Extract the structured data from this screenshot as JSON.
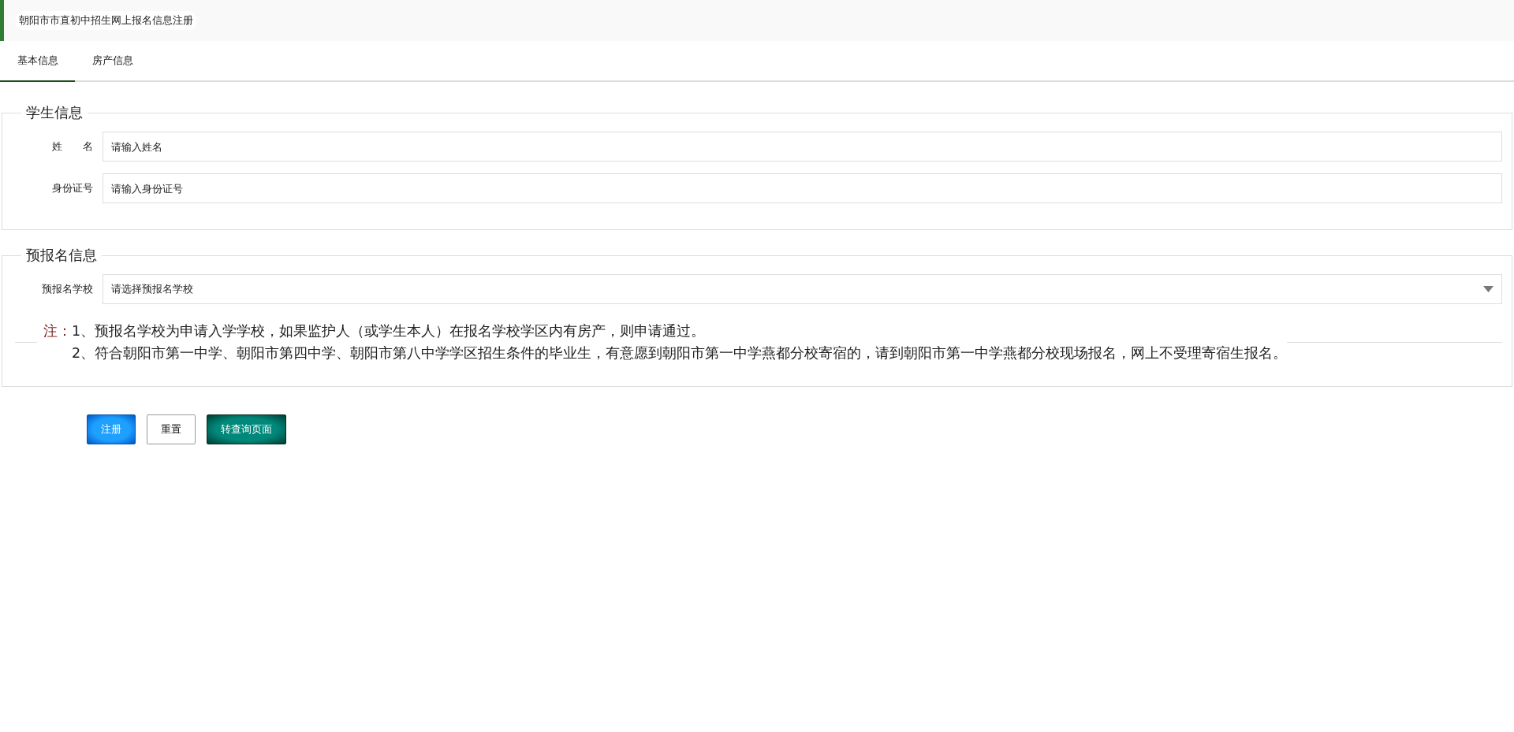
{
  "header": {
    "title": "朝阳市市直初中招生网上报名信息注册"
  },
  "tabs": [
    {
      "label": "基本信息",
      "selected": true
    },
    {
      "label": "房产信息",
      "selected": false
    }
  ],
  "student_section": {
    "legend": "学生信息",
    "fields": [
      {
        "label": "姓　　名",
        "placeholder": "请输入姓名"
      },
      {
        "label": "身份证号",
        "placeholder": "请输入身份证号"
      }
    ]
  },
  "preregistration_section": {
    "legend": "预报名信息",
    "school_select": {
      "label": "预报名学校",
      "placeholder": "请选择预报名学校"
    },
    "note": {
      "prefix": "注：",
      "lines": [
        "1、预报名学校为申请入学学校，如果监护人（或学生本人）在报名学校学区内有房产，则申请通过。",
        "2、符合朝阳市第一中学、朝阳市第四中学、朝阳市第八中学学区招生条件的毕业生，有意愿到朝阳市第一中学燕都分校寄宿的，请到朝阳市第一中学燕都分校现场报名，网上不受理寄宿生报名。"
      ]
    }
  },
  "buttons": [
    {
      "label": "注册",
      "kind": "primary"
    },
    {
      "label": "重置",
      "kind": "plain"
    },
    {
      "label": "转查询页面",
      "kind": "teal"
    }
  ]
}
